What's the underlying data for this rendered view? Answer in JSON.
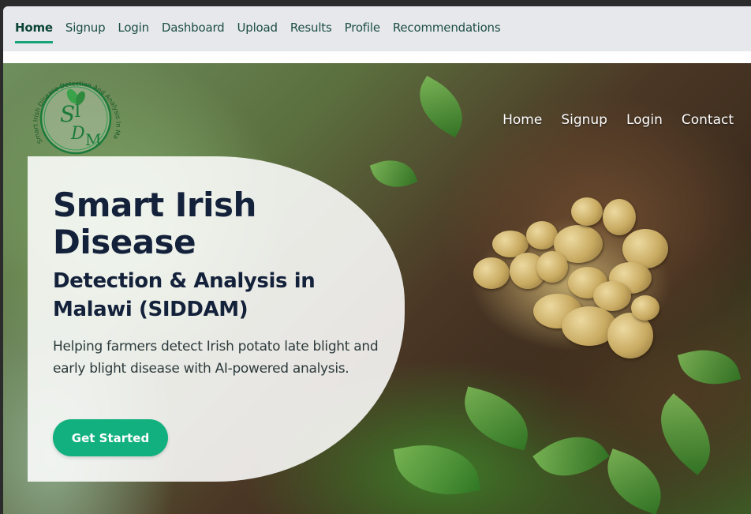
{
  "topnav": {
    "items": [
      {
        "label": "Home",
        "active": true
      },
      {
        "label": "Signup"
      },
      {
        "label": "Login"
      },
      {
        "label": "Dashboard"
      },
      {
        "label": "Upload"
      },
      {
        "label": "Results"
      },
      {
        "label": "Profile"
      },
      {
        "label": "Recommendations"
      }
    ]
  },
  "logo": {
    "ring_text": "Smart Irish Disease Detection And Analysis In Malawi",
    "monogram": "SIDM",
    "color": "#1b7a3a"
  },
  "hero_nav": {
    "items": [
      "Home",
      "Signup",
      "Login",
      "Contact"
    ]
  },
  "hero": {
    "title": "Smart Irish Disease",
    "subtitle": "Detection & Analysis in Malawi (SIDDAM)",
    "description": "Helping farmers detect Irish potato late blight and early blight disease with AI-powered analysis.",
    "cta_label": "Get Started"
  },
  "colors": {
    "accent": "#12b07e",
    "heading": "#14213a",
    "topbar_bg": "#e6e8ec"
  }
}
